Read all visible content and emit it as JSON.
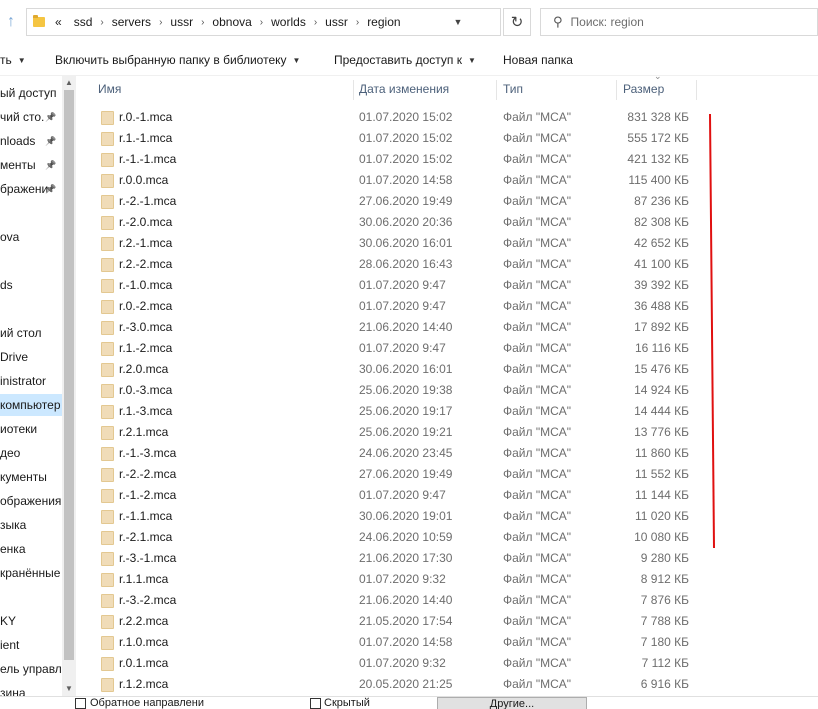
{
  "address": {
    "overflow": "«",
    "crumbs": [
      "ssd",
      "servers",
      "ussr",
      "obnova",
      "worlds",
      "ussr",
      "region"
    ]
  },
  "search": {
    "placeholder": "Поиск: region"
  },
  "commands": {
    "left_cut": "ть",
    "include_library": "Включить выбранную папку в библиотеку",
    "share": "Предоставить доступ к",
    "new_folder": "Новая папка"
  },
  "nav": {
    "items": [
      {
        "label": "ый доступ",
        "pinned": false
      },
      {
        "label": "чий сто.",
        "pinned": true
      },
      {
        "label": "nloads",
        "pinned": true
      },
      {
        "label": "менты",
        "pinned": true
      },
      {
        "label": "бражени",
        "pinned": true
      },
      {
        "label": "",
        "pinned": false
      },
      {
        "label": "ova",
        "pinned": false
      },
      {
        "label": "",
        "pinned": false
      },
      {
        "label": "ds",
        "pinned": false
      },
      {
        "label": "",
        "pinned": false
      },
      {
        "label": "ий стол",
        "pinned": false
      },
      {
        "label": "Drive",
        "pinned": false
      },
      {
        "label": "inistrator",
        "pinned": false
      },
      {
        "label": "компьютер",
        "pinned": false,
        "selected": true
      },
      {
        "label": "иотеки",
        "pinned": false
      },
      {
        "label": "део",
        "pinned": false
      },
      {
        "label": "кументы",
        "pinned": false
      },
      {
        "label": "ображения",
        "pinned": false
      },
      {
        "label": "зыка",
        "pinned": false
      },
      {
        "label": "енка",
        "pinned": false
      },
      {
        "label": "кранённые",
        "pinned": false
      },
      {
        "label": "",
        "pinned": false
      },
      {
        "label": "KY",
        "pinned": false
      },
      {
        "label": "ient",
        "pinned": false
      },
      {
        "label": "ель управле",
        "pinned": false
      },
      {
        "label": "зина",
        "pinned": false
      }
    ]
  },
  "columns": {
    "name": "Имя",
    "date": "Дата изменения",
    "type": "Тип",
    "size": "Размер"
  },
  "files": [
    {
      "name": "r.0.-1.mca",
      "date": "01.07.2020 15:02",
      "type": "Файл \"MCA\"",
      "size": "831 328 КБ"
    },
    {
      "name": "r.1.-1.mca",
      "date": "01.07.2020 15:02",
      "type": "Файл \"MCA\"",
      "size": "555 172 КБ"
    },
    {
      "name": "r.-1.-1.mca",
      "date": "01.07.2020 15:02",
      "type": "Файл \"MCA\"",
      "size": "421 132 КБ"
    },
    {
      "name": "r.0.0.mca",
      "date": "01.07.2020 14:58",
      "type": "Файл \"MCA\"",
      "size": "115 400 КБ"
    },
    {
      "name": "r.-2.-1.mca",
      "date": "27.06.2020 19:49",
      "type": "Файл \"MCA\"",
      "size": "87 236 КБ"
    },
    {
      "name": "r.-2.0.mca",
      "date": "30.06.2020 20:36",
      "type": "Файл \"MCA\"",
      "size": "82 308 КБ"
    },
    {
      "name": "r.2.-1.mca",
      "date": "30.06.2020 16:01",
      "type": "Файл \"MCA\"",
      "size": "42 652 КБ"
    },
    {
      "name": "r.2.-2.mca",
      "date": "28.06.2020 16:43",
      "type": "Файл \"MCA\"",
      "size": "41 100 КБ"
    },
    {
      "name": "r.-1.0.mca",
      "date": "01.07.2020 9:47",
      "type": "Файл \"MCA\"",
      "size": "39 392 КБ"
    },
    {
      "name": "r.0.-2.mca",
      "date": "01.07.2020 9:47",
      "type": "Файл \"MCA\"",
      "size": "36 488 КБ"
    },
    {
      "name": "r.-3.0.mca",
      "date": "21.06.2020 14:40",
      "type": "Файл \"MCA\"",
      "size": "17 892 КБ"
    },
    {
      "name": "r.1.-2.mca",
      "date": "01.07.2020 9:47",
      "type": "Файл \"MCA\"",
      "size": "16 116 КБ"
    },
    {
      "name": "r.2.0.mca",
      "date": "30.06.2020 16:01",
      "type": "Файл \"MCA\"",
      "size": "15 476 КБ"
    },
    {
      "name": "r.0.-3.mca",
      "date": "25.06.2020 19:38",
      "type": "Файл \"MCA\"",
      "size": "14 924 КБ"
    },
    {
      "name": "r.1.-3.mca",
      "date": "25.06.2020 19:17",
      "type": "Файл \"MCA\"",
      "size": "14 444 КБ"
    },
    {
      "name": "r.2.1.mca",
      "date": "25.06.2020 19:21",
      "type": "Файл \"MCA\"",
      "size": "13 776 КБ"
    },
    {
      "name": "r.-1.-3.mca",
      "date": "24.06.2020 23:45",
      "type": "Файл \"MCA\"",
      "size": "11 860 КБ"
    },
    {
      "name": "r.-2.-2.mca",
      "date": "27.06.2020 19:49",
      "type": "Файл \"MCA\"",
      "size": "11 552 КБ"
    },
    {
      "name": "r.-1.-2.mca",
      "date": "01.07.2020 9:47",
      "type": "Файл \"MCA\"",
      "size": "11 144 КБ"
    },
    {
      "name": "r.-1.1.mca",
      "date": "30.06.2020 19:01",
      "type": "Файл \"MCA\"",
      "size": "11 020 КБ"
    },
    {
      "name": "r.-2.1.mca",
      "date": "24.06.2020 10:59",
      "type": "Файл \"MCA\"",
      "size": "10 080 КБ"
    },
    {
      "name": "r.-3.-1.mca",
      "date": "21.06.2020 17:30",
      "type": "Файл \"MCA\"",
      "size": "9 280 КБ"
    },
    {
      "name": "r.1.1.mca",
      "date": "01.07.2020 9:32",
      "type": "Файл \"MCA\"",
      "size": "8 912 КБ"
    },
    {
      "name": "r.-3.-2.mca",
      "date": "21.06.2020 14:40",
      "type": "Файл \"MCA\"",
      "size": "7 876 КБ"
    },
    {
      "name": "r.2.2.mca",
      "date": "21.05.2020 17:54",
      "type": "Файл \"MCA\"",
      "size": "7 788 КБ"
    },
    {
      "name": "r.1.0.mca",
      "date": "01.07.2020 14:58",
      "type": "Файл \"MCA\"",
      "size": "7 180 КБ"
    },
    {
      "name": "r.0.1.mca",
      "date": "01.07.2020 9:32",
      "type": "Файл \"MCA\"",
      "size": "7 112 КБ"
    },
    {
      "name": "r.1.2.mca",
      "date": "20.05.2020 21:25",
      "type": "Файл \"MCA\"",
      "size": "6 916 КБ"
    }
  ],
  "bottom": {
    "reverse_label": "Обратное направлени",
    "hidden_label": "Скрытый",
    "other_button": "Другие..."
  },
  "colors": {
    "selection": "#cce8ff",
    "annotation_line": "#e01010",
    "header_text": "#4c607a"
  }
}
